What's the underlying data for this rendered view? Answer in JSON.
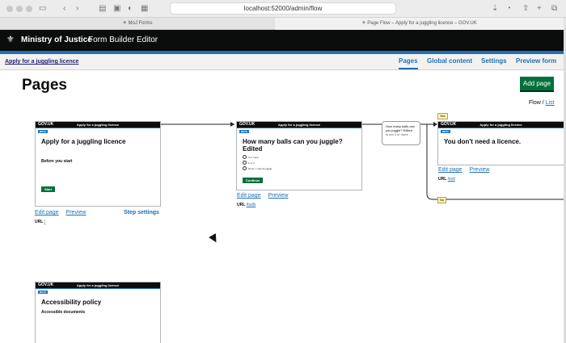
{
  "browser": {
    "url": "localhost:52000/admin/flow",
    "tabs": [
      {
        "label": "MoJ Forms"
      },
      {
        "label": "Page Flow – Apply for a juggling licence – GOV.UK"
      }
    ]
  },
  "header": {
    "brand": "Ministry of Justice",
    "product": "Form Builder Editor"
  },
  "subnav": {
    "service_name": "Apply for a juggling licence",
    "links": [
      "Pages",
      "Global content",
      "Settings",
      "Preview form"
    ]
  },
  "main": {
    "title": "Pages",
    "add_page_label": "Add page",
    "view_toggle": {
      "flow": "Flow",
      "separator": " / ",
      "list": "List"
    }
  },
  "cards": {
    "start": {
      "header_logo": "GOV.UK",
      "header_title": "Apply for a juggling licence",
      "heading": "Apply for a juggling licence",
      "subheading": "Before you start",
      "button": "Start",
      "edit": "Edit page",
      "preview": "Preview",
      "step_settings": "Step settings",
      "url_label": "URL",
      "url_value": "/"
    },
    "question": {
      "header_logo": "GOV.UK",
      "header_title": "Apply for a juggling licence",
      "heading": "How many balls can you juggle? Edited",
      "options": [
        "3 or more",
        "1 or 2",
        "None / I cannot juggle"
      ],
      "button": "Continue",
      "edit": "Edit page",
      "preview": "Preview",
      "url_label": "URL",
      "url_value": "/balls"
    },
    "exit": {
      "header_logo": "GOV.UK",
      "header_title": "Apply for a juggling licence",
      "heading": "You don't need a licence.",
      "edit": "Edit page",
      "preview": "Preview",
      "url_label": "URL",
      "url_value": "/exit"
    },
    "accessibility": {
      "header_logo": "GOV.UK",
      "header_title": "Apply for a juggling licence",
      "heading": "Accessibility policy",
      "subheading": "Accessible documents"
    }
  },
  "branch": {
    "question": "How many balls can you juggle? Edited",
    "condition": "is not 3 or more",
    "yes": "Yes",
    "no": "No"
  }
}
